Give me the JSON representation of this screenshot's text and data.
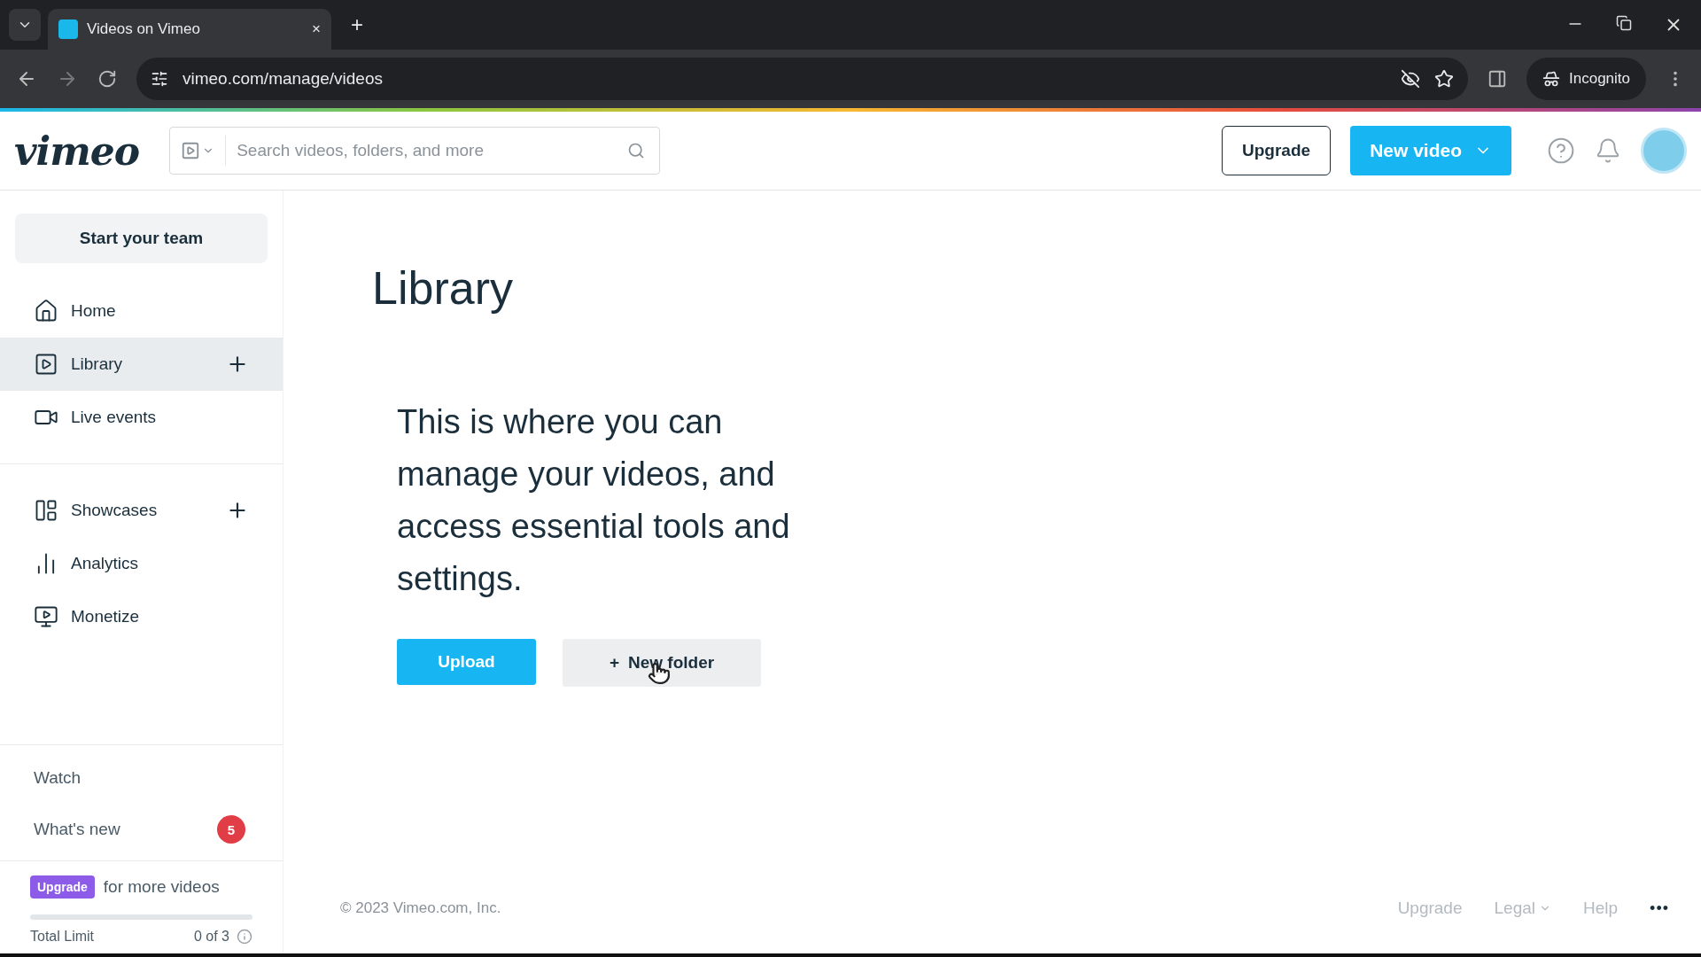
{
  "browser": {
    "tab_title": "Videos on Vimeo",
    "tab_close": "×",
    "new_tab": "+",
    "url": "vimeo.com/manage/videos",
    "profile": "Incognito"
  },
  "header": {
    "logo": "vimeo",
    "search_placeholder": "Search videos, folders, and more",
    "upgrade": "Upgrade",
    "new_video": "New video"
  },
  "sidebar": {
    "team_button": "Start your team",
    "items": [
      {
        "kind": "home",
        "label": "Home",
        "selected": false,
        "add": false
      },
      {
        "kind": "library",
        "label": "Library",
        "selected": true,
        "add": true
      },
      {
        "kind": "live",
        "label": "Live events",
        "selected": false,
        "add": false
      },
      {
        "kind": "showcases",
        "label": "Showcases",
        "selected": false,
        "add": true
      },
      {
        "kind": "analytics",
        "label": "Analytics",
        "selected": false,
        "add": false
      },
      {
        "kind": "monetize",
        "label": "Monetize",
        "selected": false,
        "add": false
      }
    ],
    "links": [
      {
        "label": "Watch"
      },
      {
        "label": "What's new",
        "badge": "5"
      }
    ],
    "upgrade_badge": "Upgrade",
    "upgrade_text": "for more videos",
    "limit": {
      "label": "Total Limit",
      "value": "0 of 3",
      "level": 0
    }
  },
  "main": {
    "title": "Library",
    "message": "This is where you can manage your videos, and access essential tools and settings.",
    "upload": "Upload",
    "new_folder": "New folder",
    "new_folder_icon": "+"
  },
  "footer": {
    "copyright": "© 2023 Vimeo.com, Inc.",
    "links": [
      {
        "label": "Upgrade",
        "dropdown": false
      },
      {
        "label": "Legal",
        "dropdown": true
      },
      {
        "label": "Help",
        "dropdown": false
      }
    ],
    "more": "•••"
  }
}
